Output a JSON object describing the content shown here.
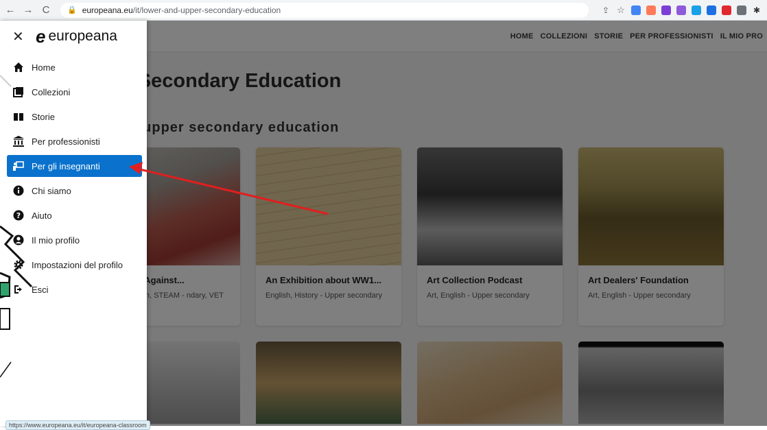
{
  "browser": {
    "url_domain": "europeana.eu",
    "url_path": "/it/lower-and-upper-secondary-education",
    "status_url": "https://www.europeana.eu/it/europeana-classroom"
  },
  "header": {
    "nav": [
      "HOME",
      "COLLEZIONI",
      "STORIE",
      "PER PROFESSIONISTI",
      "IL MIO PRO"
    ]
  },
  "page": {
    "title": "r and Upper Secondary Education",
    "section_title": "ng scenarios for upper secondary education"
  },
  "cards": [
    {
      "title": "rs at War Against...",
      "sub": "ation, English, STEAM - ndary, VET"
    },
    {
      "title": "An Exhibition about WW1...",
      "sub": "English, History - Upper secondary"
    },
    {
      "title": "Art Collection Podcast",
      "sub": "Art, English - Upper secondary"
    },
    {
      "title": "Art Dealers' Foundation",
      "sub": "Art, English - Upper secondary"
    }
  ],
  "sidebar": {
    "logo_text": "europeana",
    "items": [
      {
        "label": "Home",
        "icon": "home-icon"
      },
      {
        "label": "Collezioni",
        "icon": "collections-icon"
      },
      {
        "label": "Storie",
        "icon": "stories-icon"
      },
      {
        "label": "Per professionisti",
        "icon": "institution-icon"
      },
      {
        "label": "Per gli insegnanti",
        "icon": "teacher-icon"
      },
      {
        "label": "Chi siamo",
        "icon": "info-icon"
      },
      {
        "label": "Aiuto",
        "icon": "help-icon"
      },
      {
        "label": "Il mio profilo",
        "icon": "user-icon"
      },
      {
        "label": "Impostazioni del profilo",
        "icon": "gear-icon"
      },
      {
        "label": "Esci",
        "icon": "logout-icon"
      }
    ],
    "active_index": 4
  },
  "colors": {
    "active": "#0a72cc",
    "arrow": "#e01f1f"
  }
}
